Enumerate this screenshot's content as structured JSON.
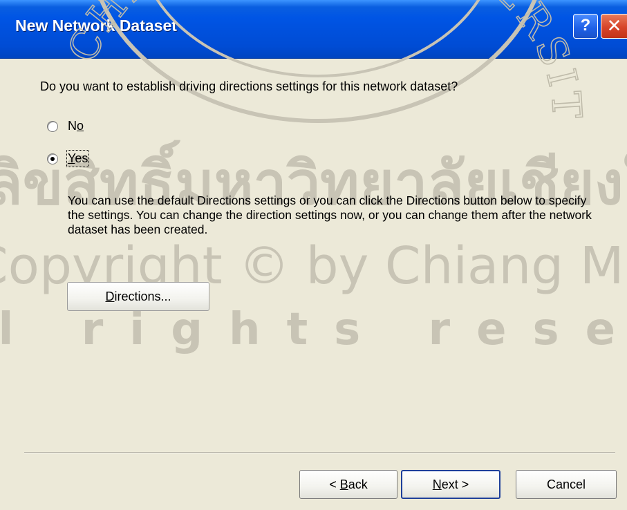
{
  "window": {
    "title": "New Network Dataset",
    "help_glyph": "?",
    "close_glyph": "✕"
  },
  "question": "Do you want to establish driving directions settings for this network dataset?",
  "options": [
    {
      "pre": "N",
      "mnemonic": "o",
      "post": "",
      "selected": false
    },
    {
      "pre": "",
      "mnemonic": "Y",
      "post": "es",
      "selected": true
    }
  ],
  "info_text": "You can use the default Directions settings or you can click the Directions button below to specify the settings. You can change the direction settings now, or you can change them after the network dataset has been created.",
  "directions_button": {
    "mnemonic": "D",
    "rest": "irections..."
  },
  "footer": {
    "back": {
      "pre": "< ",
      "mnemonic": "B",
      "rest": "ack"
    },
    "next": {
      "mnemonic": "N",
      "rest": "ext >"
    },
    "cancel": "Cancel"
  },
  "watermark": {
    "line1": "ลิขสิทธิ์มหาวิทยาลัยเชียงใหม่",
    "line2": "Copyright © by Chiang Mai University",
    "line3": "All rights reserved",
    "seal_text": "CHIANG MAI UNIVERSITY"
  },
  "colors": {
    "titlebar": "#0055E5",
    "dialog_bg": "#ECE9D8",
    "watermark": "#C8C4B5"
  }
}
